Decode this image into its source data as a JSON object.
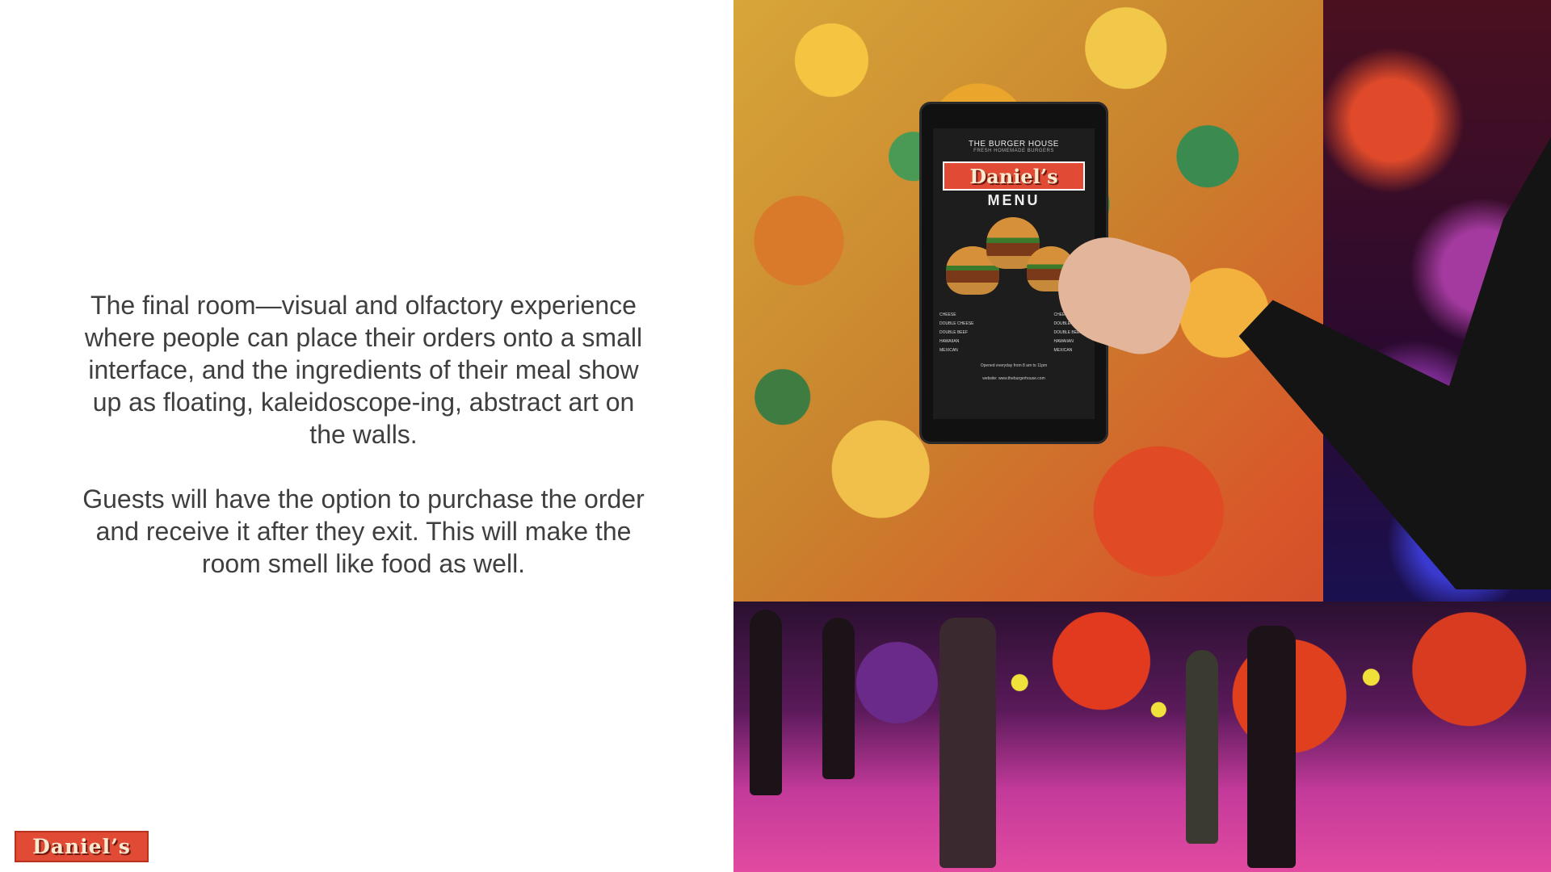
{
  "slide": {
    "paragraphs": [
      "The final room—visual and olfactory experience where people can place their orders onto a small interface, and the ingredients of their meal show up as floating, kaleidoscope-ing, abstract art on the walls.",
      "Guests will have the option to purchase the order and receive it after they exit. This will make the room smell like food as well."
    ],
    "logo_text": "Daniel’s"
  },
  "tablet_menu": {
    "house_name": "THE BURGER HOUSE",
    "tagline": "FRESH HOMEMADE BURGERS",
    "logo_text": "Daniel’s",
    "menu_word": "MENU",
    "items_col1": [
      "CHEESE",
      "DOUBLE CHEESE",
      "DOUBLE BEEF",
      "HAWAIIAN",
      "MEXICAN"
    ],
    "items_col2": [
      "CHEESE",
      "DOUBLE CHEESE",
      "DOUBLE BEEF",
      "HAWAIIAN",
      "MEXICAN"
    ],
    "footer": "Opened everyday from 8 am to 11pm",
    "website": "website: www.theburgerhouse.com"
  },
  "colors": {
    "brand_red": "#e14b36",
    "logo_text": "#f8ead0",
    "body_text": "#3f3f3f"
  }
}
